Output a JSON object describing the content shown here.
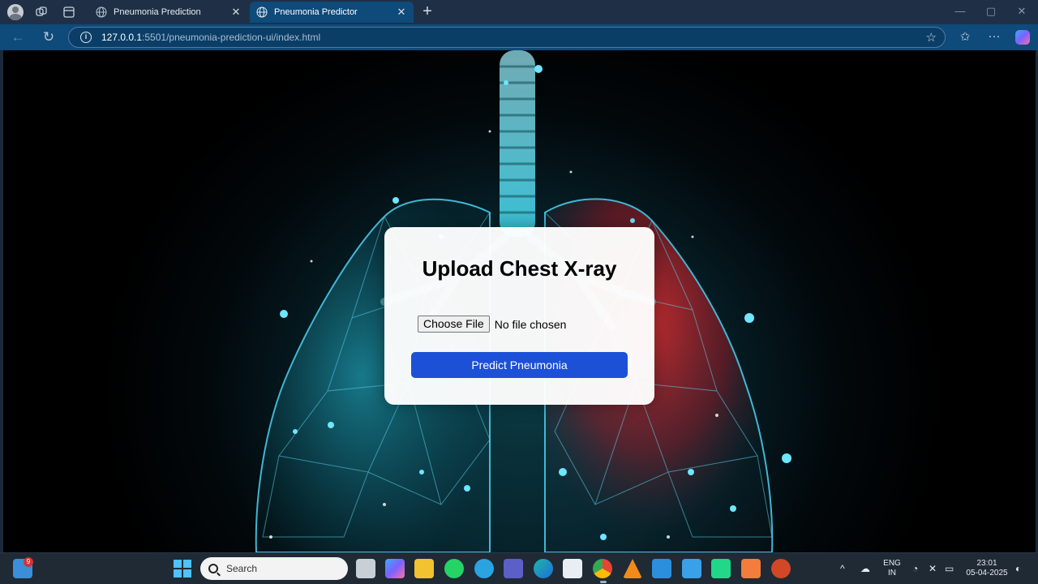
{
  "browser": {
    "tabs": [
      {
        "title": "Pneumonia Prediction",
        "active": false
      },
      {
        "title": "Pneumonia Predictor",
        "active": true
      }
    ],
    "url_host": "127.0.0.1",
    "url_rest": ":5501/pneumonia-prediction-ui/index.html",
    "icons": [
      "profile-icon",
      "workspaces-icon",
      "tab-actions-icon",
      "globe-icon",
      "close-icon",
      "new-tab-icon",
      "back-icon",
      "refresh-icon",
      "info-icon",
      "favorite-star-icon",
      "favorites-icon",
      "more-icon",
      "copilot-icon"
    ]
  },
  "page": {
    "heading": "Upload Chest X-ray",
    "file_button": "Choose File",
    "file_status": "No file chosen",
    "predict_button": "Predict Pneumonia",
    "colors": {
      "button": "#1c50d6",
      "left_lung": "#29c6e6",
      "right_lung": "#ff3b3b"
    }
  },
  "taskbar": {
    "widget_badge": "9",
    "search_placeholder": "Search",
    "apps": [
      "start-icon",
      "task-view-icon",
      "copilot-icon",
      "file-explorer-icon",
      "whatsapp-icon",
      "telegram-icon",
      "teams-icon",
      "edge-icon",
      "store-icon",
      "chrome-icon",
      "vlc-icon",
      "vscode-icon",
      "notepad-icon",
      "pycharm-icon",
      "paint-icon",
      "powerpoint-icon"
    ],
    "language_top": "ENG",
    "language_bottom": "IN",
    "time": "23:01",
    "date": "05-04-2025"
  }
}
